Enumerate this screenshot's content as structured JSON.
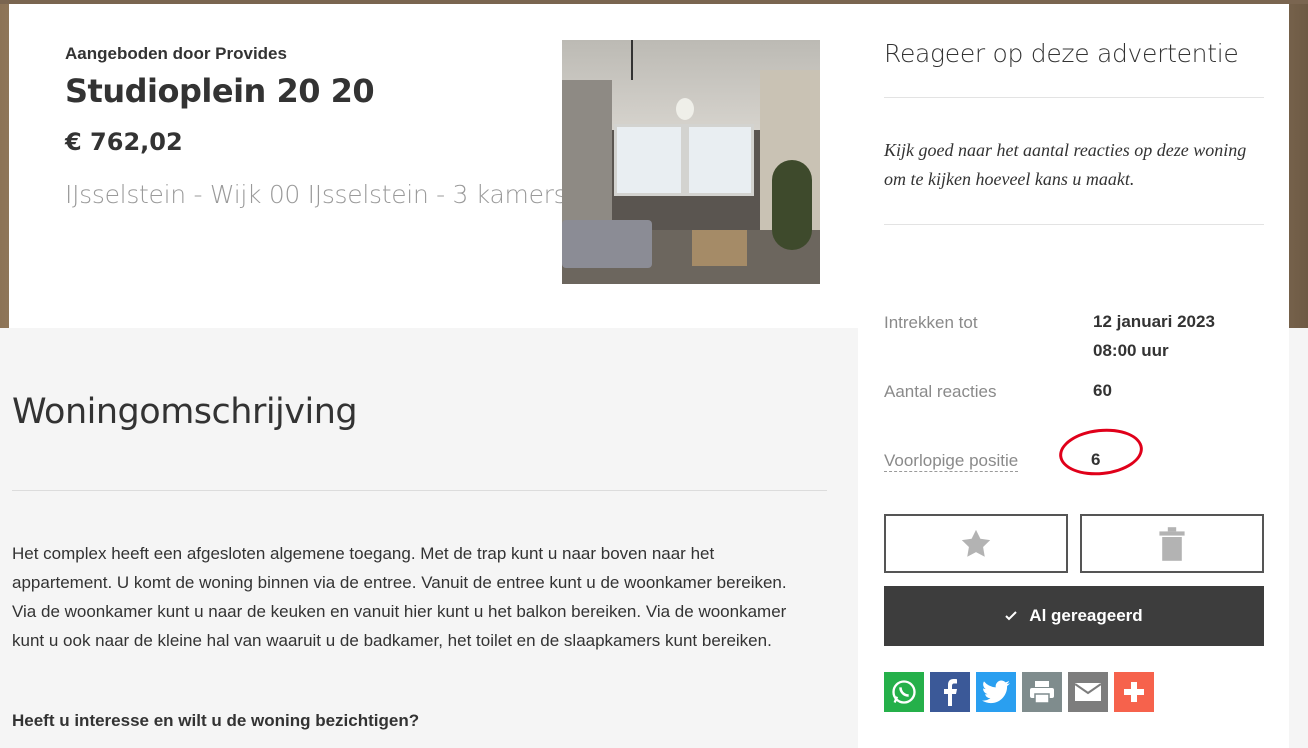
{
  "listing": {
    "provider": "Aangeboden door Provides",
    "title": "Studioplein 20 20",
    "price": "€ 762,02",
    "location": "IJsselstein - Wijk 00 IJsselstein - 3 kamers"
  },
  "sidebar": {
    "title": "Reageer op deze advertentie",
    "note": "Kijk goed naar het aantal reacties op deze woning om te kijken hoeveel kans u maakt.",
    "withdraw_label": "Intrekken tot",
    "withdraw_date": "12 januari 2023",
    "withdraw_time": "08:00 uur",
    "reactions_label": "Aantal reacties",
    "reactions_value": "60",
    "position_label": "Voorlopige positie",
    "position_value": "6",
    "reacted_button": "Al gereageerd",
    "share": [
      {
        "name": "whatsapp-icon",
        "color": "#25b04a"
      },
      {
        "name": "facebook-icon",
        "color": "#3b5998"
      },
      {
        "name": "twitter-icon",
        "color": "#2a9ff0"
      },
      {
        "name": "print-icon",
        "color": "#7f8c8d"
      },
      {
        "name": "email-icon",
        "color": "#7d7d7d"
      },
      {
        "name": "more-icon",
        "color": "#f6624c"
      }
    ]
  },
  "description": {
    "title": "Woningomschrijving",
    "text": "Het complex heeft een afgesloten algemene toegang. Met de trap kunt u naar boven naar het appartement. U komt de woning binnen via de entree. Vanuit de entree kunt u de woonkamer bereiken. Via de woonkamer kunt u naar de keuken en vanuit hier kunt u het balkon bereiken. Via de woonkamer kunt u ook naar de kleine hal van waaruit u de badkamer, het toilet en de slaapkamers kunt bereiken.",
    "question": "Heeft u interesse en wilt u de woning bezichtigen?"
  }
}
